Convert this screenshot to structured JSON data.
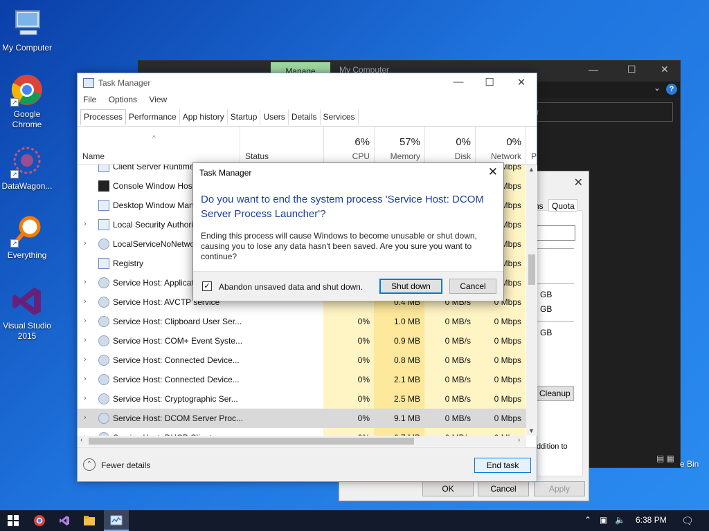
{
  "desktop_icons": [
    {
      "name": "mycomputer",
      "label": "My Computer"
    },
    {
      "name": "chrome",
      "label": "Google Chrome"
    },
    {
      "name": "datawagon",
      "label": "DataWagon..."
    },
    {
      "name": "everything",
      "label": "Everything"
    },
    {
      "name": "vs",
      "label": "Visual Studio 2015"
    }
  ],
  "bg_explorer": {
    "manage_tab": "Manage",
    "title": "My Computer",
    "search_hint": "r"
  },
  "props": {
    "tab_ns": "ns",
    "tab_quota": "Quota",
    "gb1": "GB",
    "gb2": "GB",
    "gb3": "GB",
    "cleanup": "Cleanup",
    "addn": "ddition to",
    "ok": "OK",
    "cancel": "Cancel",
    "apply": "Apply"
  },
  "recycle_label": "e Bin",
  "tm": {
    "title": "Task Manager",
    "menu": [
      "File",
      "Options",
      "View"
    ],
    "tabs": [
      "Processes",
      "Performance",
      "App history",
      "Startup",
      "Users",
      "Details",
      "Services"
    ],
    "header": {
      "name": "Name",
      "status": "Status",
      "cpu_pct": "6%",
      "cpu": "CPU",
      "mem_pct": "57%",
      "mem": "Memory",
      "disk_pct": "0%",
      "disk": "Disk",
      "net_pct": "0%",
      "net": "Network",
      "extra": "P"
    },
    "rows": [
      {
        "name": "Client Server Runtime",
        "cpu": "",
        "mem": "",
        "disk": "",
        "net": "Mbps",
        "expand": false,
        "icon": "window"
      },
      {
        "name": "Console Window Host",
        "cpu": "",
        "mem": "",
        "disk": "",
        "net": "Mbps",
        "expand": false,
        "icon": "cmd"
      },
      {
        "name": "Desktop Window Man",
        "cpu": "",
        "mem": "",
        "disk": "",
        "net": "Mbps",
        "expand": false,
        "icon": "window"
      },
      {
        "name": "Local Security Authori",
        "cpu": "",
        "mem": "",
        "disk": "",
        "net": "Mbps",
        "expand": true,
        "icon": "window"
      },
      {
        "name": "LocalServiceNoNetwo",
        "cpu": "",
        "mem": "",
        "disk": "",
        "net": "Mbps",
        "expand": true,
        "icon": "gear"
      },
      {
        "name": "Registry",
        "cpu": "",
        "mem": "",
        "disk": "",
        "net": "Mbps",
        "expand": false,
        "icon": "window"
      },
      {
        "name": "Service Host: Applicat",
        "cpu": "",
        "mem": "",
        "disk": "",
        "net": "Mbps",
        "expand": true,
        "icon": "gear"
      },
      {
        "name": "Service Host: AVCTP service",
        "cpu": "",
        "mem": "0.4 MB",
        "disk": "0 MB/s",
        "net": "0 Mbps",
        "expand": true,
        "icon": "gear"
      },
      {
        "name": "Service Host: Clipboard User Ser...",
        "cpu": "0%",
        "mem": "1.0 MB",
        "disk": "0 MB/s",
        "net": "0 Mbps",
        "expand": true,
        "icon": "gear"
      },
      {
        "name": "Service Host: COM+ Event Syste...",
        "cpu": "0%",
        "mem": "0.9 MB",
        "disk": "0 MB/s",
        "net": "0 Mbps",
        "expand": true,
        "icon": "gear"
      },
      {
        "name": "Service Host: Connected Device...",
        "cpu": "0%",
        "mem": "0.8 MB",
        "disk": "0 MB/s",
        "net": "0 Mbps",
        "expand": true,
        "icon": "gear"
      },
      {
        "name": "Service Host: Connected Device...",
        "cpu": "0%",
        "mem": "2.1 MB",
        "disk": "0 MB/s",
        "net": "0 Mbps",
        "expand": true,
        "icon": "gear"
      },
      {
        "name": "Service Host: Cryptographic Ser...",
        "cpu": "0%",
        "mem": "2.5 MB",
        "disk": "0 MB/s",
        "net": "0 Mbps",
        "expand": true,
        "icon": "gear"
      },
      {
        "name": "Service Host: DCOM Server Proc...",
        "cpu": "0%",
        "mem": "9.1 MB",
        "disk": "0 MB/s",
        "net": "0 Mbps",
        "expand": true,
        "icon": "gear",
        "selected": true
      },
      {
        "name": "Service Host: DHCP Client",
        "cpu": "0%",
        "mem": "0.7 MB",
        "disk": "0 MB/s",
        "net": "0 Mbps",
        "expand": true,
        "icon": "gear"
      }
    ],
    "footer": {
      "fewer": "Fewer details",
      "end_task": "End task"
    }
  },
  "dialog": {
    "title": "Task Manager",
    "main": "Do you want to end the system process 'Service Host: DCOM Server Process Launcher'?",
    "body": "Ending this process will cause Windows to become unusable or shut down, causing you to lose any data hasn't been saved. Are you sure you want to continue?",
    "checkbox_label": "Abandon unsaved data and shut down.",
    "checked": true,
    "shutdown": "Shut down",
    "cancel": "Cancel"
  },
  "taskbar": {
    "time": "6:38 PM"
  },
  "colors": {
    "accent": "#0078d7",
    "dialog_title": "#1a3f99",
    "cpu_fill": "#fff4c4",
    "mem_fill": "#fde89b"
  }
}
